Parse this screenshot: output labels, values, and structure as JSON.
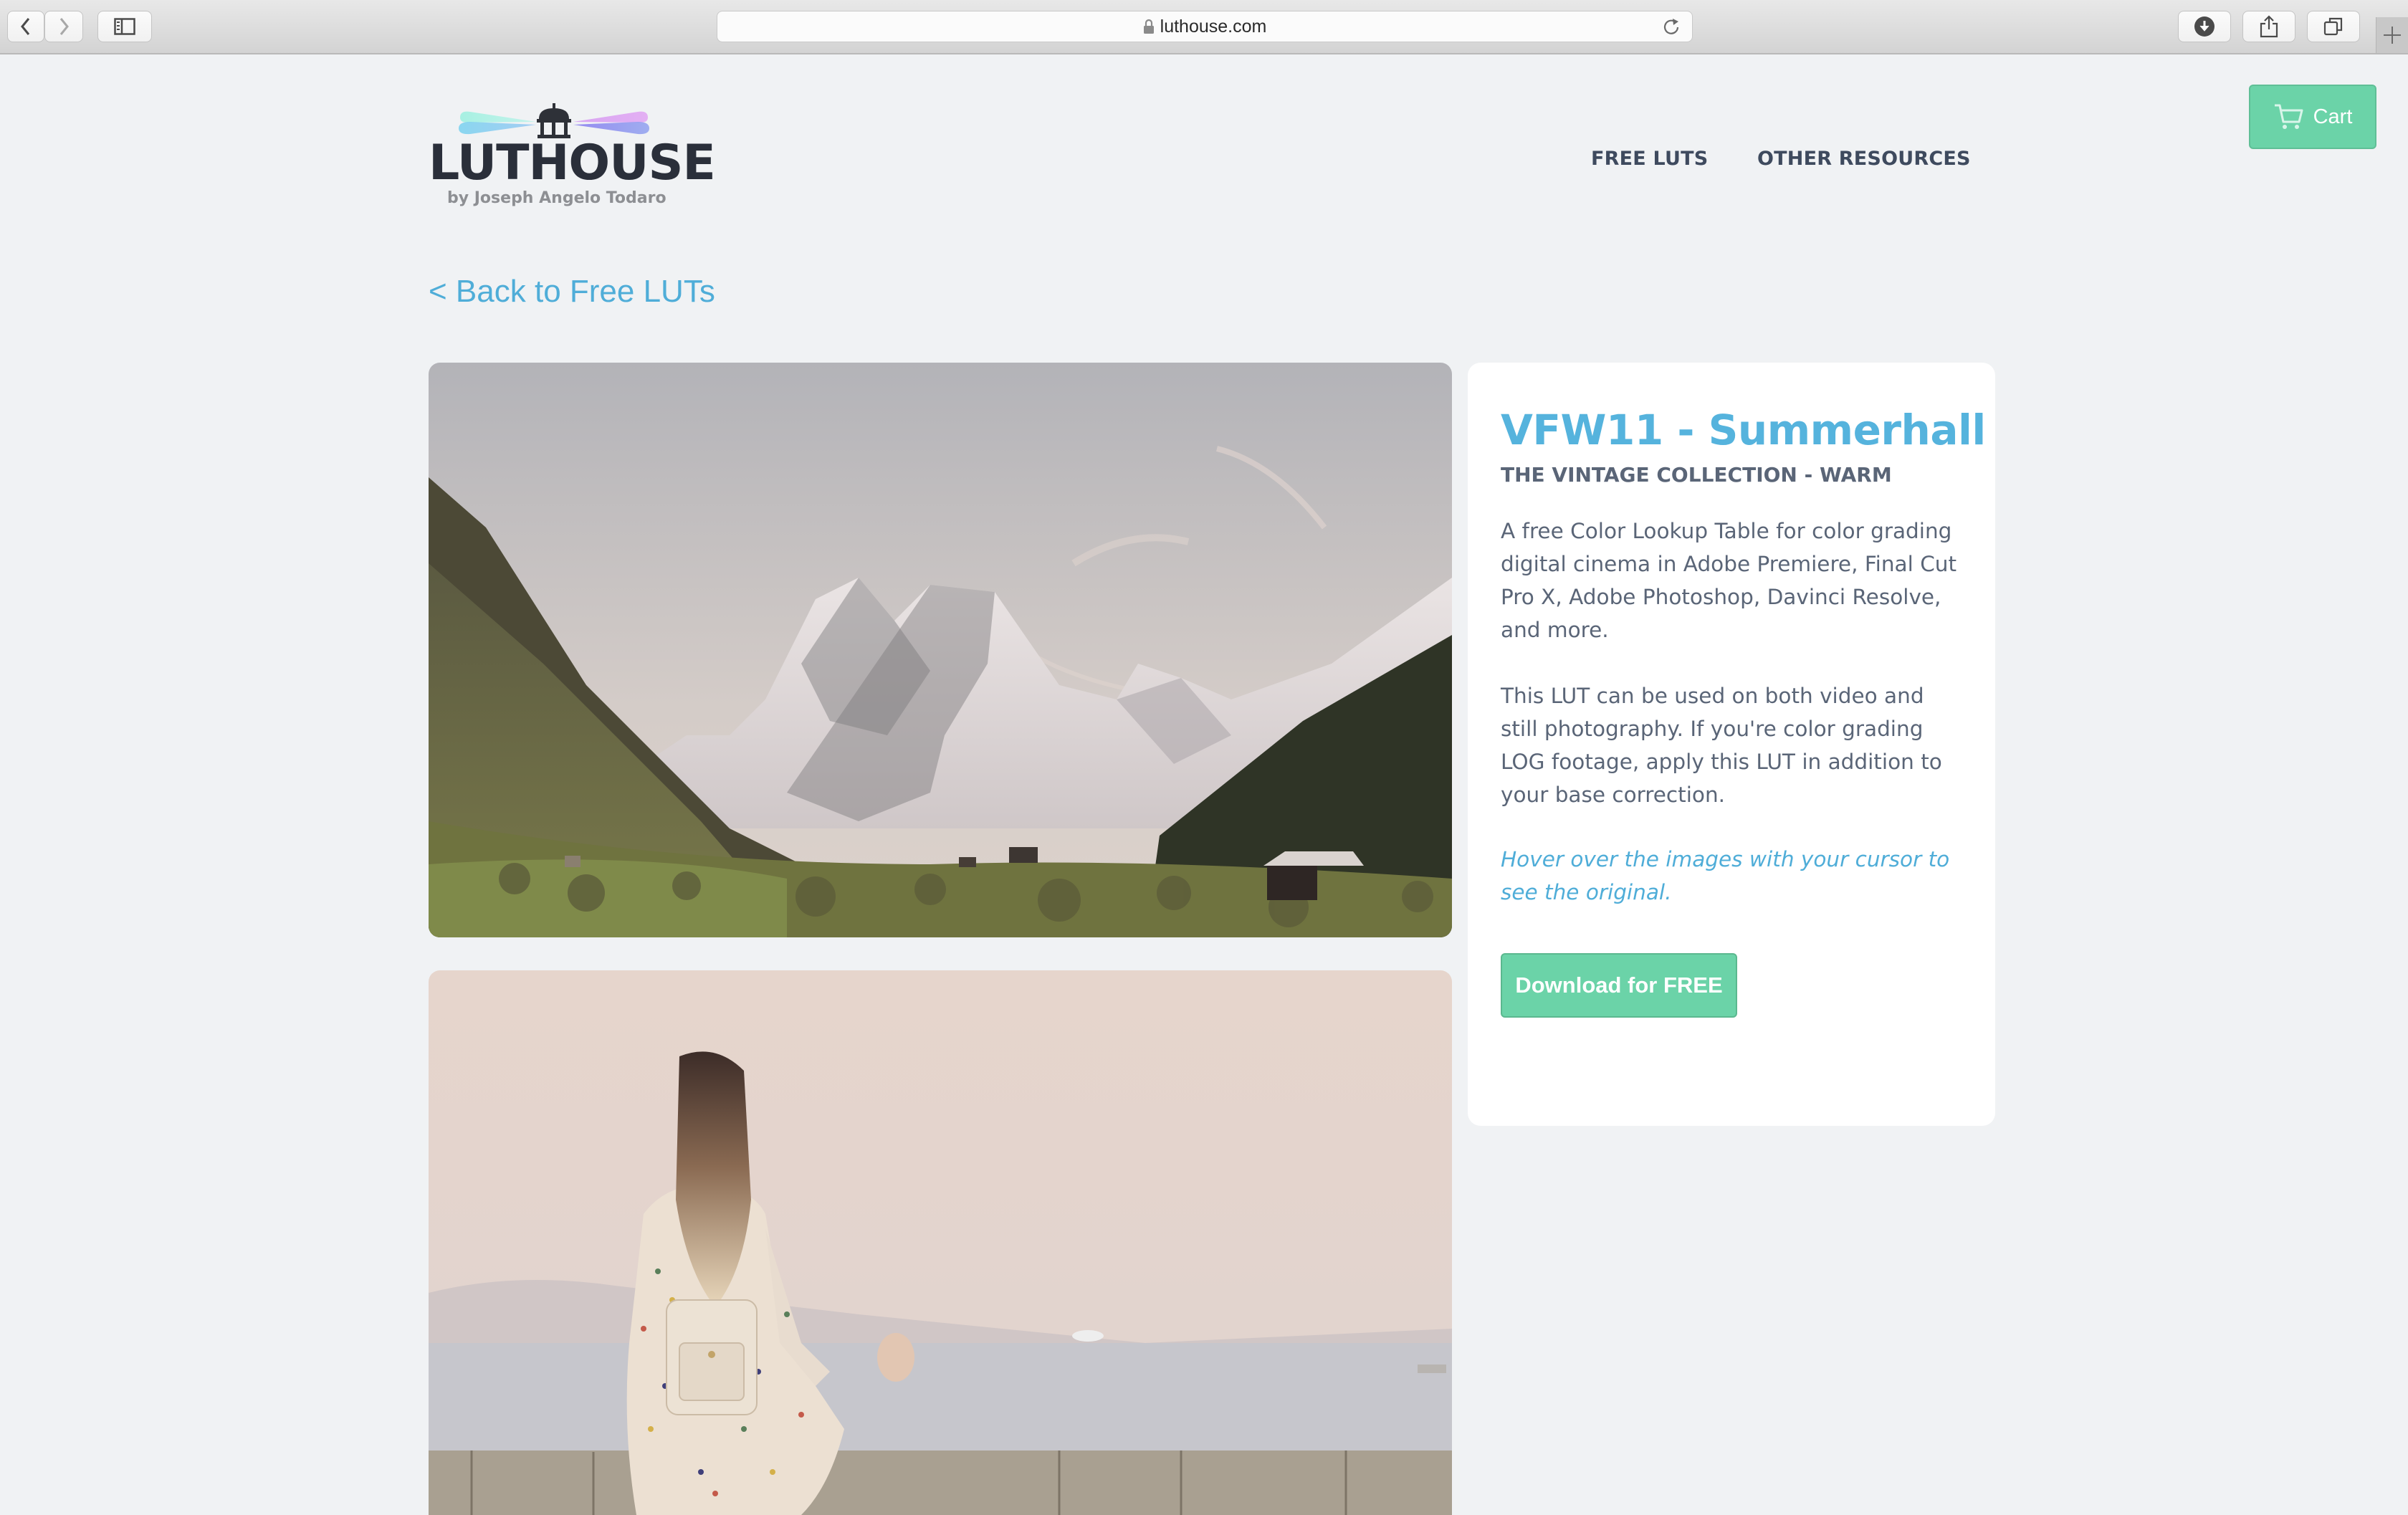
{
  "browser": {
    "url": "luthouse.com",
    "buttons": {
      "back": "back-icon",
      "forward": "forward-icon",
      "sidebar": "sidebar-icon",
      "downloads": "download-icon",
      "share": "share-icon",
      "tabs": "tabs-overview-icon",
      "new_tab": "plus-icon"
    }
  },
  "header": {
    "logo_word": "LUTHOUSE",
    "logo_byline": "by Joseph Angelo Todaro",
    "nav": [
      {
        "label": "FREE LUTS"
      },
      {
        "label": "OTHER RESOURCES"
      }
    ],
    "cart_label": "Cart"
  },
  "page": {
    "back_link": "< Back to Free LUTs",
    "images": [
      {
        "alt": "Snowy mountain valley with village and forests"
      },
      {
        "alt": "Woman with long ombre hair in patterned dress looking at the sea"
      }
    ],
    "product": {
      "title": "VFW11 - Summerhall",
      "collection": "THE VINTAGE COLLECTION - WARM",
      "description_1": "A free Color Lookup Table for color grading digital cinema in Adobe Premiere, Final Cut Pro X, Adobe Photoshop, Davinci Resolve, and more.",
      "description_2": "This LUT can be used on both video and still photography. If you're color grading LOG footage, apply this LUT in addition to your base correction.",
      "hover_note": "Hover over the images with your cursor to see the original.",
      "download_label": "Download for FREE"
    }
  },
  "colors": {
    "accent_blue": "#55b3dd",
    "accent_green": "#6bd3a8",
    "text_dark": "#3e4a5e",
    "page_bg": "#f0f2f4"
  }
}
